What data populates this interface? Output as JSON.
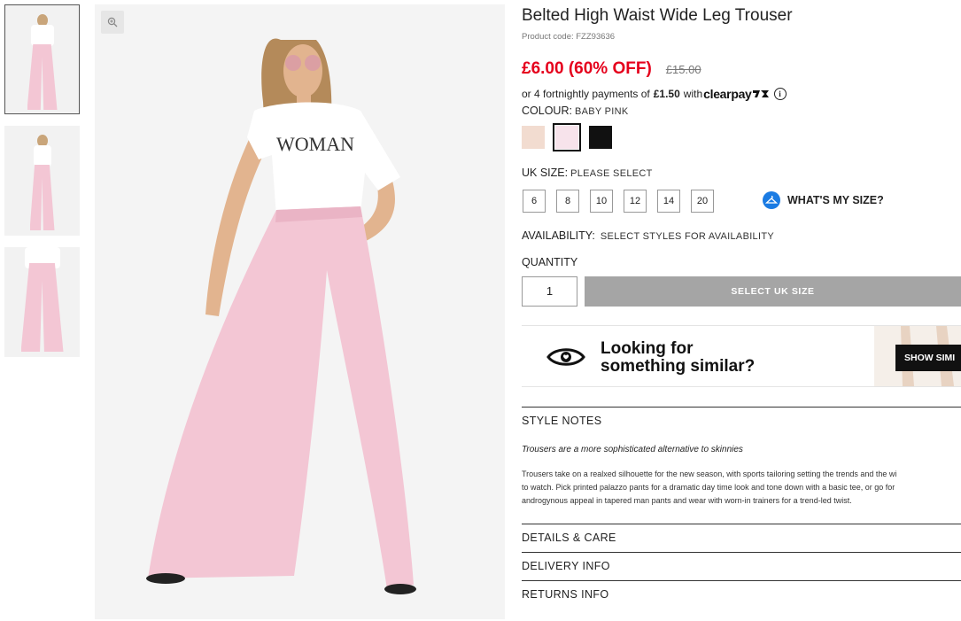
{
  "product": {
    "title": "Belted High Waist Wide Leg Trouser",
    "code": "Product code: FZZ93636",
    "price": "£6.00 (60% OFF)",
    "was_price": "£15.00"
  },
  "clearpay": {
    "prefix": "or 4 fortnightly payments of",
    "amount": "£1.50",
    "with": "with",
    "brand": "clearpay"
  },
  "colour": {
    "label": "COLOUR:",
    "value": "BABY PINK",
    "swatches": [
      "#f2dcd0",
      "#f7e3eb",
      "#111111"
    ]
  },
  "size": {
    "label": "UK SIZE:",
    "value": "PLEASE SELECT",
    "options": [
      "6",
      "8",
      "10",
      "12",
      "14",
      "20"
    ],
    "guide": "WHAT'S MY SIZE?"
  },
  "availability": {
    "label": "AVAILABILITY:",
    "value": "SELECT STYLES FOR AVAILABILITY"
  },
  "quantity": {
    "label": "QUANTITY",
    "value": "1"
  },
  "cta": "SELECT UK SIZE",
  "similar": {
    "line1": "Looking for",
    "line2": "something similar?",
    "button": "SHOW SIMI"
  },
  "style_notes": {
    "heading": "STYLE NOTES",
    "tagline": "Trousers are a more sophisticated alternative to skinnies",
    "body1": "Trousers take on a realxed silhouette for the new season, with sports tailoring setting the trends and the wi",
    "body2": "to watch. Pick printed palazzo pants for a dramatic day time look and tone down with a basic tee, or go for",
    "body3": "androgynous appeal in tapered man pants and wear with worn-in trainers for a trend-led twist."
  },
  "accordions": {
    "details": "DETAILS & CARE",
    "delivery": "DELIVERY INFO",
    "returns": "RETURNS INFO"
  },
  "colors": {
    "price_red": "#e5001c",
    "cta_grey": "#a5a5a5",
    "size_guide_blue": "#1a7be3"
  }
}
